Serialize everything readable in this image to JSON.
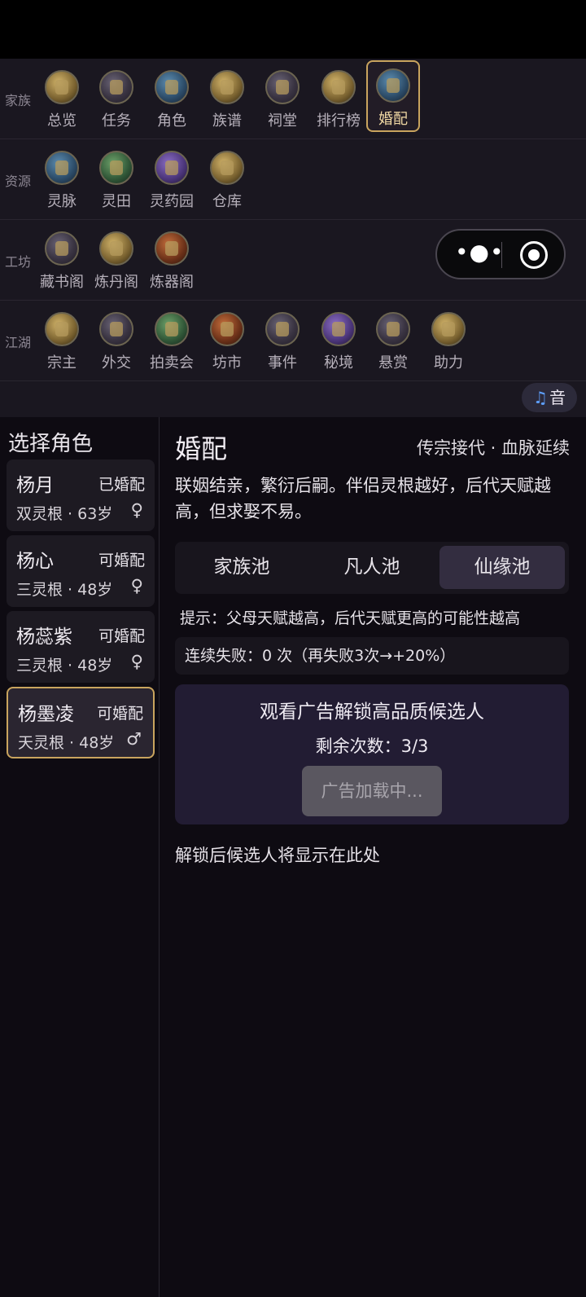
{
  "nav": {
    "rows": [
      {
        "label": "家族",
        "items": [
          {
            "label": "总览",
            "icon": "overview-icon"
          },
          {
            "label": "任务",
            "icon": "task-scroll-icon"
          },
          {
            "label": "角色",
            "icon": "character-icon"
          },
          {
            "label": "族谱",
            "icon": "family-tree-icon"
          },
          {
            "label": "祠堂",
            "icon": "ancestral-hall-icon"
          },
          {
            "label": "排行榜",
            "icon": "leaderboard-icon"
          },
          {
            "label": "婚配",
            "icon": "marriage-icon"
          }
        ]
      },
      {
        "label": "资源",
        "items": [
          {
            "label": "灵脉",
            "icon": "spirit-vein-icon"
          },
          {
            "label": "灵田",
            "icon": "spirit-field-icon"
          },
          {
            "label": "灵药园",
            "icon": "herb-garden-icon"
          },
          {
            "label": "仓库",
            "icon": "warehouse-icon"
          }
        ]
      },
      {
        "label": "工坊",
        "items": [
          {
            "label": "藏书阁",
            "icon": "library-icon"
          },
          {
            "label": "炼丹阁",
            "icon": "alchemy-icon"
          },
          {
            "label": "炼器阁",
            "icon": "forge-icon"
          }
        ]
      },
      {
        "label": "江湖",
        "items": [
          {
            "label": "宗主",
            "icon": "sect-master-icon"
          },
          {
            "label": "外交",
            "icon": "diplomacy-icon"
          },
          {
            "label": "拍卖会",
            "icon": "auction-icon"
          },
          {
            "label": "坊市",
            "icon": "market-scale-icon"
          },
          {
            "label": "事件",
            "icon": "event-icon"
          },
          {
            "label": "秘境",
            "icon": "secret-realm-icon"
          },
          {
            "label": "悬赏",
            "icon": "bounty-icon"
          },
          {
            "label": "助力",
            "icon": "support-icon"
          }
        ]
      }
    ],
    "active_item": "婚配"
  },
  "music_button": {
    "icon": "music-note-icon",
    "label": "音"
  },
  "role_panel": {
    "title": "选择角色",
    "roles": [
      {
        "name": "杨月",
        "status": "已婚配",
        "info": "双灵根 · 63岁",
        "gender": "♀"
      },
      {
        "name": "杨心",
        "status": "可婚配",
        "info": "三灵根 · 48岁",
        "gender": "♀"
      },
      {
        "name": "杨蕊紫",
        "status": "可婚配",
        "info": "三灵根 · 48岁",
        "gender": "♀"
      },
      {
        "name": "杨墨凌",
        "status": "可婚配",
        "info": "天灵根 · 48岁",
        "gender": "♂"
      }
    ],
    "selected": "杨墨凌"
  },
  "main": {
    "title": "婚配",
    "subtitle": "传宗接代 · 血脉延续",
    "description": "联姻结亲，繁衍后嗣。伴侣灵根越好，后代天赋越高，但求娶不易。",
    "tabs": [
      "家族池",
      "凡人池",
      "仙缘池"
    ],
    "active_tab": "仙缘池",
    "hint": "提示：父母天赋越高，后代天赋更高的可能性越高",
    "fail_text": "连续失败：0 次（再失败3次→+20%）",
    "ad": {
      "title": "观看广告解锁高品质候选人",
      "remaining": "剩余次数：3/3",
      "button": "广告加载中..."
    },
    "empty_note": "解锁后候选人将显示在此处"
  },
  "colors": {
    "accent_gold": "#c9a45e",
    "background": "#0e0b12",
    "nav_background": "#1a1720",
    "ad_panel": "#221c33"
  }
}
